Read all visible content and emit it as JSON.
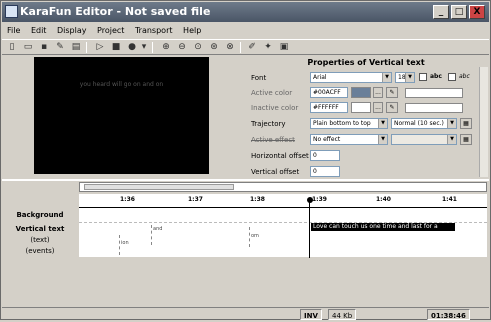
{
  "window": {
    "title": "KaraFun Editor - Not saved file"
  },
  "titlebar_buttons": {
    "minimize": "_",
    "maximize": "□",
    "close": "X"
  },
  "menu": [
    "File",
    "Edit",
    "Display",
    "Project",
    "Transport",
    "Help"
  ],
  "preview": {
    "text": "you heard will go on and on"
  },
  "properties": {
    "title": "Properties of Vertical text",
    "font_label": "Font",
    "font_value": "Arial",
    "font_size": "18",
    "bold_label": "abc",
    "italic_label": "abc",
    "active_color_label": "Active color",
    "active_color_value": "#00ACFF",
    "inactive_color_label": "Inactive color",
    "inactive_color_value": "#FFFFFF",
    "trajectory_label": "Trajectory",
    "trajectory_value": "Plain bottom to top",
    "trajectory_speed": "Normal (10 sec.)",
    "active_effect_label": "Active effect",
    "active_effect_value": "No effect",
    "horizontal_offset_label": "Horizontal offset",
    "horizontal_offset_value": "0",
    "vertical_offset_label": "Vertical offset",
    "vertical_offset_value": "0",
    "ellipsis": "..."
  },
  "timeline": {
    "ticks": [
      "1:36",
      "1:37",
      "1:38",
      "1:39",
      "1:40",
      "1:41"
    ],
    "tracks": {
      "background": "Background",
      "vertical_text": "Vertical text",
      "text": "(text)",
      "events": "(events)"
    },
    "events": [
      "and",
      "ion",
      "om"
    ],
    "highlight_text": "Love can touch us one time and last for a"
  },
  "status": {
    "mode": "INV",
    "sample": "44 Kb",
    "time": "01:38:46"
  },
  "colors": {
    "active_swatch": "#6a7f99",
    "inactive_swatch": "#ffffff"
  }
}
